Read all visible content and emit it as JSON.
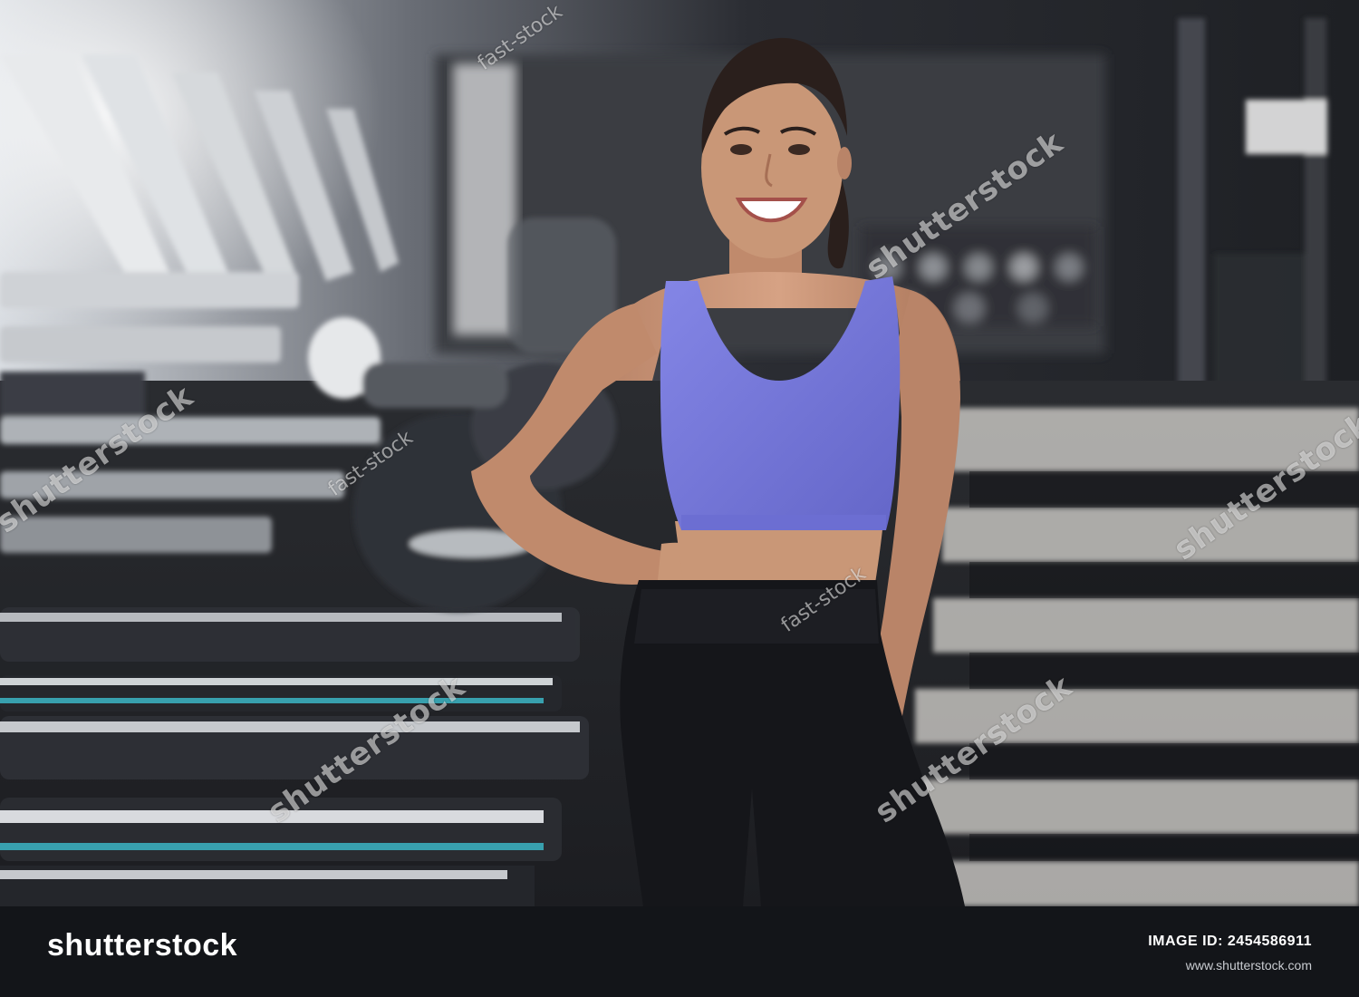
{
  "watermarks": {
    "brand": "shutterstock",
    "tag": "fast-stock"
  },
  "footer": {
    "logo_text": "shutterstock",
    "image_id_label": "IMAGE ID:",
    "image_id_value": "2454586911",
    "site": "www.shutterstock.com"
  },
  "colors": {
    "top": "#7b7ee0",
    "leggings": "#15161a",
    "skin": "#c99777",
    "hair": "#2a1f1c",
    "footer_bg": "#131519"
  }
}
